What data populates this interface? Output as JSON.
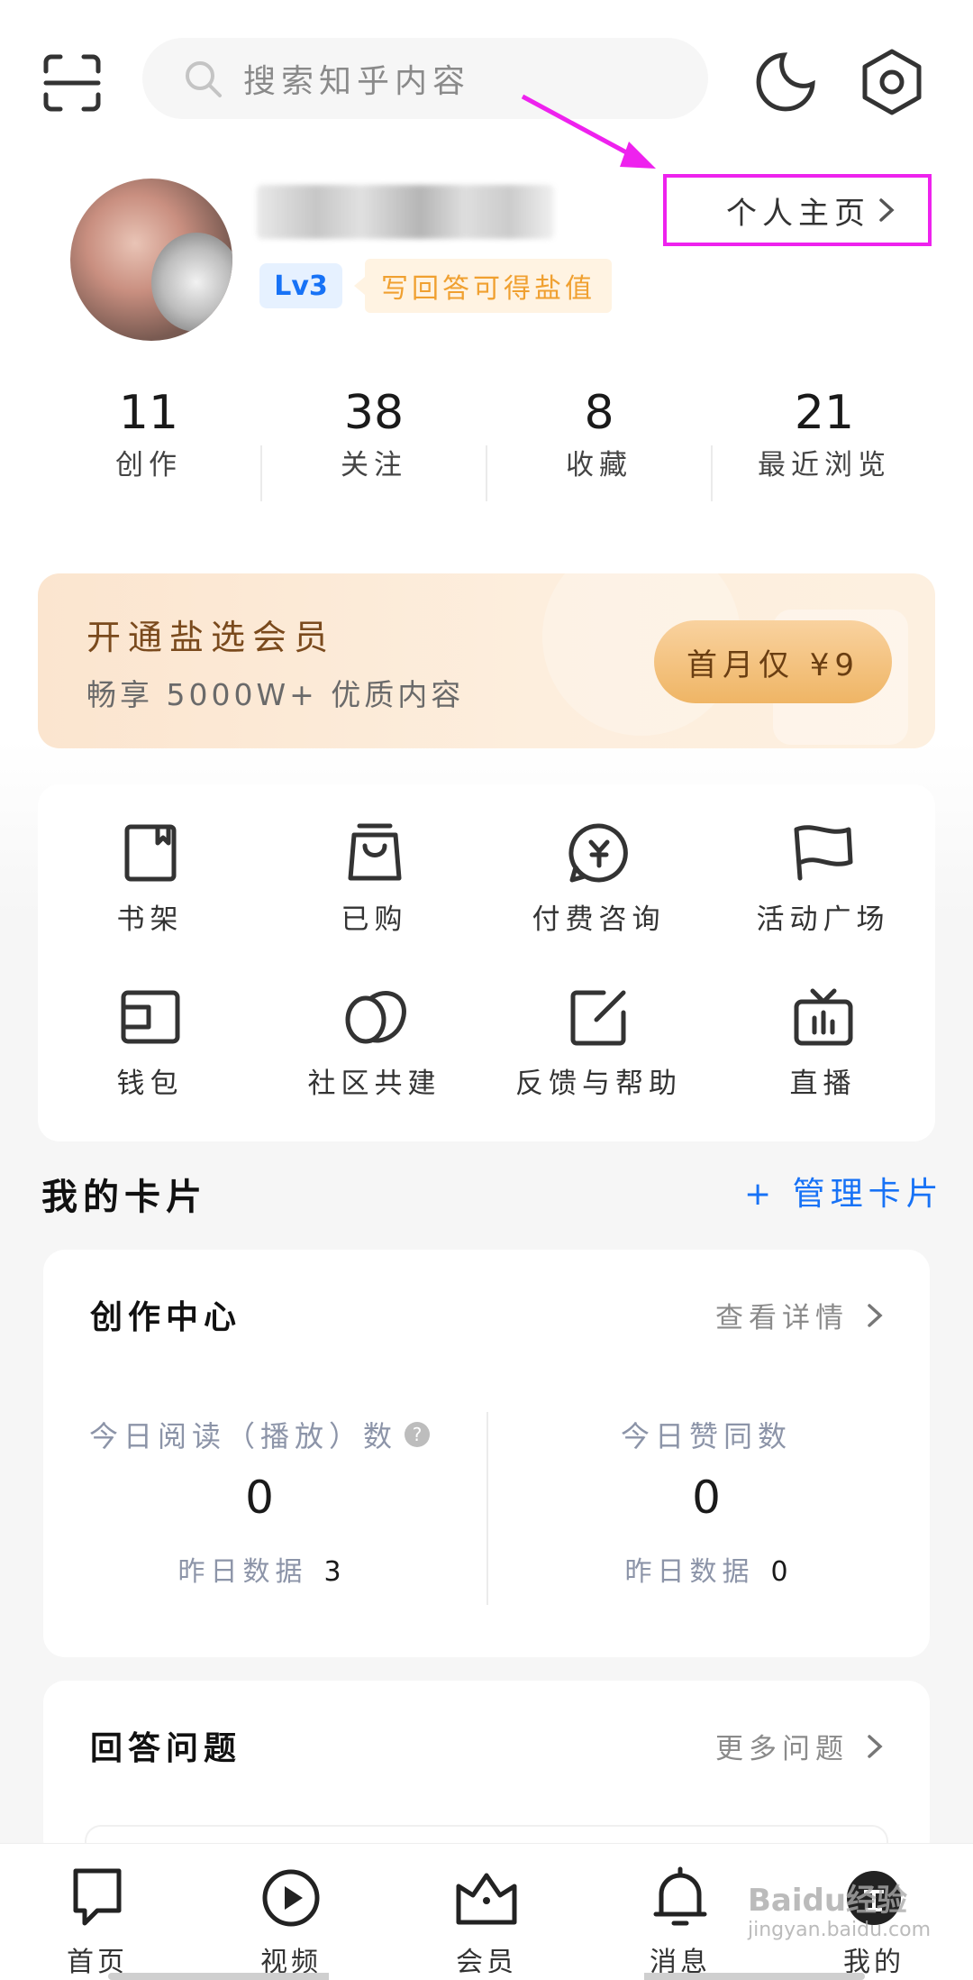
{
  "top_bar": {
    "search_placeholder": "搜索知乎内容"
  },
  "profile": {
    "level": "Lv3",
    "tip": "写回答可得盐值",
    "homepage_link": "个人主页"
  },
  "stats": [
    {
      "value": "11",
      "label": "创作"
    },
    {
      "value": "38",
      "label": "关注"
    },
    {
      "value": "8",
      "label": "收藏"
    },
    {
      "value": "21",
      "label": "最近浏览"
    }
  ],
  "member_banner": {
    "title": "开通盐选会员",
    "subtitle": "畅享 5000W+ 优质内容",
    "button": "首月仅 ¥9"
  },
  "grid": [
    {
      "label": "书架",
      "icon": "bookshelf-icon"
    },
    {
      "label": "已购",
      "icon": "shopping-bag-icon"
    },
    {
      "label": "付费咨询",
      "icon": "paid-consult-icon"
    },
    {
      "label": "活动广场",
      "icon": "flag-icon"
    },
    {
      "label": "钱包",
      "icon": "wallet-icon"
    },
    {
      "label": "社区共建",
      "icon": "community-icon"
    },
    {
      "label": "反馈与帮助",
      "icon": "feedback-icon"
    },
    {
      "label": "直播",
      "icon": "live-tv-icon"
    }
  ],
  "cards_section": {
    "title": "我的卡片",
    "manage": "+ 管理卡片"
  },
  "creation_center": {
    "title": "创作中心",
    "more": "查看详情",
    "read_label": "今日阅读（播放）数",
    "read_value": "0",
    "read_yesterday_label": "昨日数据",
    "read_yesterday_value": "3",
    "likes_label": "今日赞同数",
    "likes_value": "0",
    "likes_yesterday_label": "昨日数据",
    "likes_yesterday_value": "0"
  },
  "answer_questions": {
    "title": "回答问题",
    "more": "更多问题"
  },
  "bottom_nav": [
    {
      "label": "首页",
      "icon": "home-icon"
    },
    {
      "label": "视频",
      "icon": "video-play-icon"
    },
    {
      "label": "会员",
      "icon": "crown-icon"
    },
    {
      "label": "消息",
      "icon": "bell-icon"
    },
    {
      "label": "我的",
      "icon": "profile-icon"
    }
  ],
  "watermark": {
    "brand": "Baidu经验",
    "site": "jingyan.baidu.com"
  },
  "colors": {
    "accent_blue": "#1772f6",
    "annotation_magenta": "#ee22ee",
    "gold": "#efb565"
  }
}
